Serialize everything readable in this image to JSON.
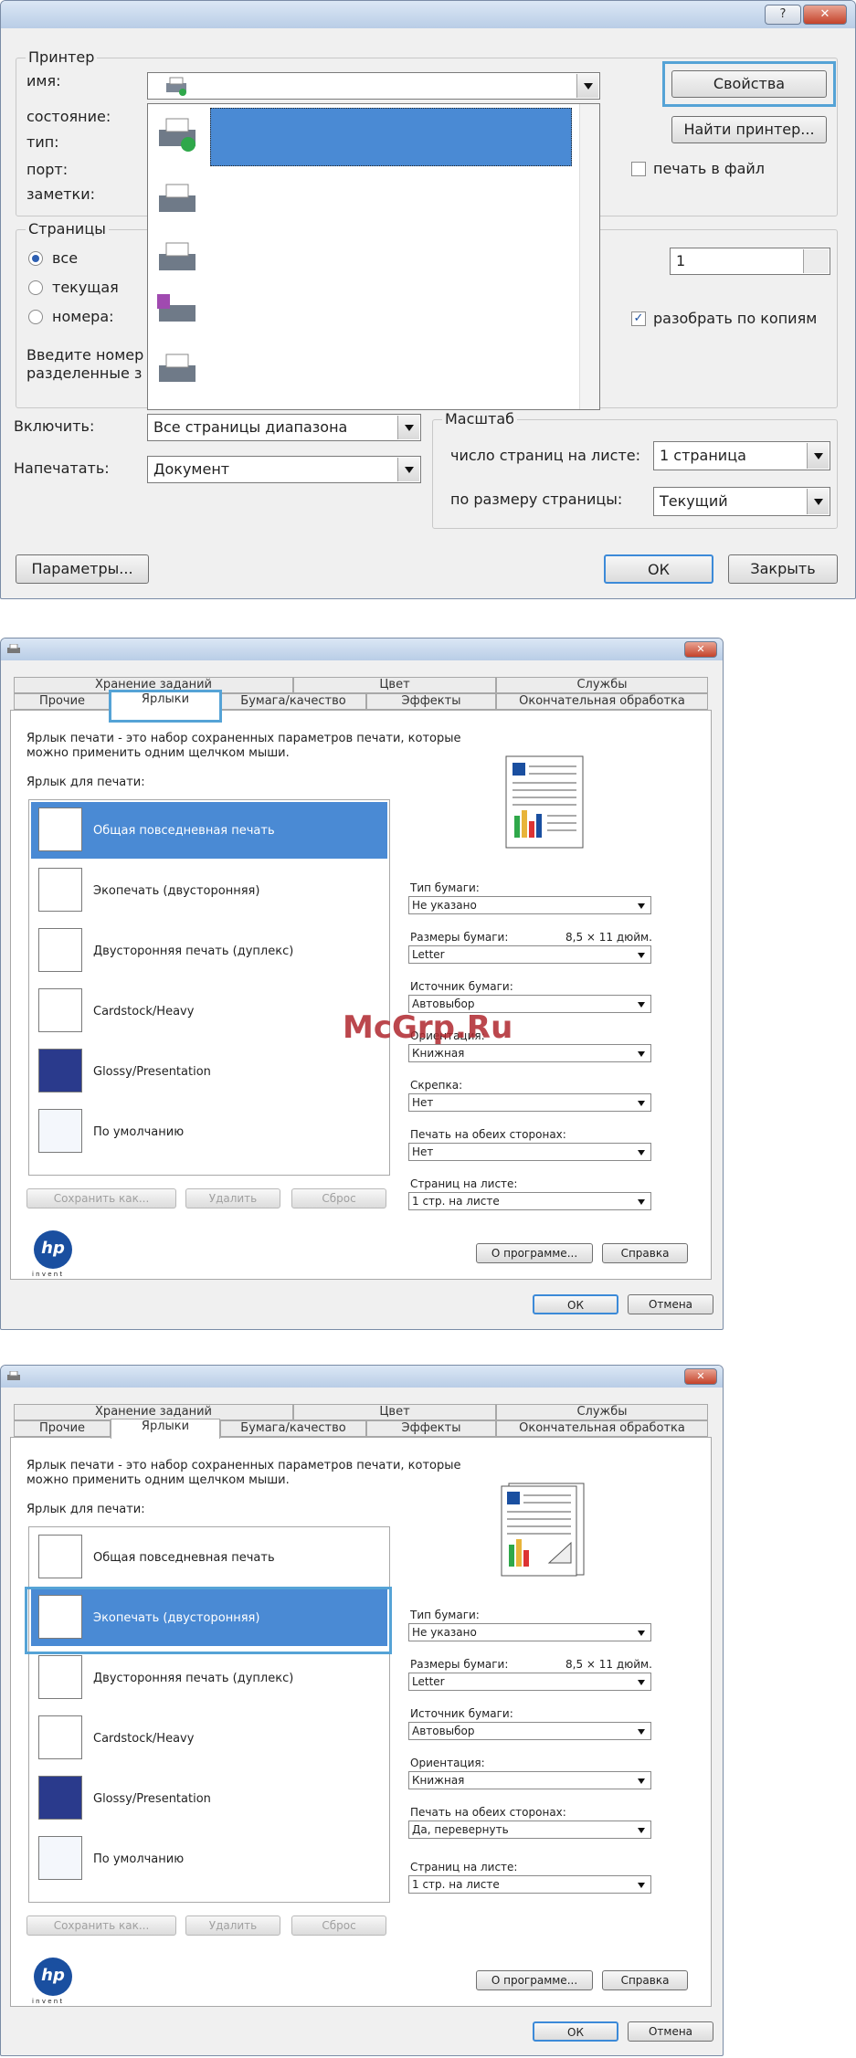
{
  "print_dialog": {
    "help_glyph": "?",
    "close_glyph": "✕",
    "printer_group": "Принтер",
    "name_label": "имя:",
    "status_label": "состояние:",
    "type_label": "тип:",
    "port_label": "порт:",
    "comments_label": "заметки:",
    "properties_button": "Свойства",
    "find_printer_button": "Найти принтер...",
    "print_to_file_label": "печать в файл",
    "pages_group": "Страницы",
    "all_label": "все",
    "current_label": "текущая",
    "numbers_label": "номера:",
    "hint_line1": "Введите номер",
    "hint_line2": "разделенные з",
    "copies_value": "1",
    "collate_label": "разобрать по копиям",
    "include_label": "Включить:",
    "include_value": "Все страницы диапазона",
    "print_label": "Напечатать:",
    "print_value": "Документ",
    "scale_group": "Масштаб",
    "pages_per_sheet_label": "число страниц на листе:",
    "pages_per_sheet_value": "1 страница",
    "fit_label": "по размеру страницы:",
    "fit_value": "Текущий",
    "options_button": "Параметры...",
    "ok_button": "ОК",
    "close_button": "Закрыть"
  },
  "props1": {
    "tabs_top": [
      "Хранение заданий",
      "Цвет",
      "Службы"
    ],
    "tabs_bottom": [
      "Прочие",
      "Ярлыки",
      "Бумага/качество",
      "Эффекты",
      "Окончательная обработка"
    ],
    "desc_line1": "Ярлык печати - это набор сохраненных параметров печати, которые",
    "desc_line2": "можно применить одним щелчком мыши.",
    "shortcuts_label": "Ярлык для печати:",
    "shortcuts": [
      "Общая повседневная печать",
      "Экопечать (двусторонняя)",
      "Двусторонняя печать (дуплекс)",
      "Cardstock/Heavy",
      "Glossy/Presentation",
      "По умолчанию"
    ],
    "paper_type_label": "Тип бумаги:",
    "paper_type_value": "Не указано",
    "paper_size_label": "Размеры бумаги:",
    "paper_size_dim": "8,5 × 11 дюйм.",
    "paper_size_value": "Letter",
    "source_label": "Источник бумаги:",
    "source_value": "Автовыбор",
    "orientation_label": "Ориентация:",
    "orientation_value": "Книжная",
    "staple_label": "Скрепка:",
    "staple_value": "Нет",
    "duplex_label": "Печать на обеих сторонах:",
    "duplex_value": "Нет",
    "pps_label": "Страниц на листе:",
    "pps_value": "1 стр. на листе",
    "save_as_button": "Сохранить как...",
    "delete_button": "Удалить",
    "reset_button": "Сброс",
    "about_button": "О программе...",
    "help_button": "Справка",
    "ok_button": "ОК",
    "cancel_button": "Отмена",
    "hp_text": "hp",
    "invent_text": "i n v e n t",
    "watermark": "McGrp.Ru",
    "close_glyph": "✕"
  },
  "props2": {
    "tabs_top": [
      "Хранение заданий",
      "Цвет",
      "Службы"
    ],
    "tabs_bottom": [
      "Прочие",
      "Ярлыки",
      "Бумага/качество",
      "Эффекты",
      "Окончательная обработка"
    ],
    "desc_line1": "Ярлык печати - это набор сохраненных параметров печати, которые",
    "desc_line2": "можно применить одним щелчком мыши.",
    "shortcuts_label": "Ярлык для печати:",
    "shortcuts": [
      "Общая повседневная печать",
      "Экопечать (двусторонняя)",
      "Двусторонняя печать (дуплекс)",
      "Cardstock/Heavy",
      "Glossy/Presentation",
      "По умолчанию"
    ],
    "paper_type_label": "Тип бумаги:",
    "paper_type_value": "Не указано",
    "paper_size_label": "Размеры бумаги:",
    "paper_size_dim": "8,5 × 11 дюйм.",
    "paper_size_value": "Letter",
    "source_label": "Источник бумаги:",
    "source_value": "Автовыбор",
    "orientation_label": "Ориентация:",
    "orientation_value": "Книжная",
    "duplex_label": "Печать на обеих сторонах:",
    "duplex_value": "Да, перевернуть",
    "pps_label": "Страниц на листе:",
    "pps_value": "1 стр. на листе",
    "save_as_button": "Сохранить как...",
    "delete_button": "Удалить",
    "reset_button": "Сброс",
    "about_button": "О программе...",
    "help_button": "Справка",
    "ok_button": "ОК",
    "cancel_button": "Отмена",
    "hp_text": "hp",
    "invent_text": "i n v e n t",
    "close_glyph": "✕"
  },
  "colors": {
    "accent": "#55a3d6",
    "selection": "#4a8ad4"
  }
}
